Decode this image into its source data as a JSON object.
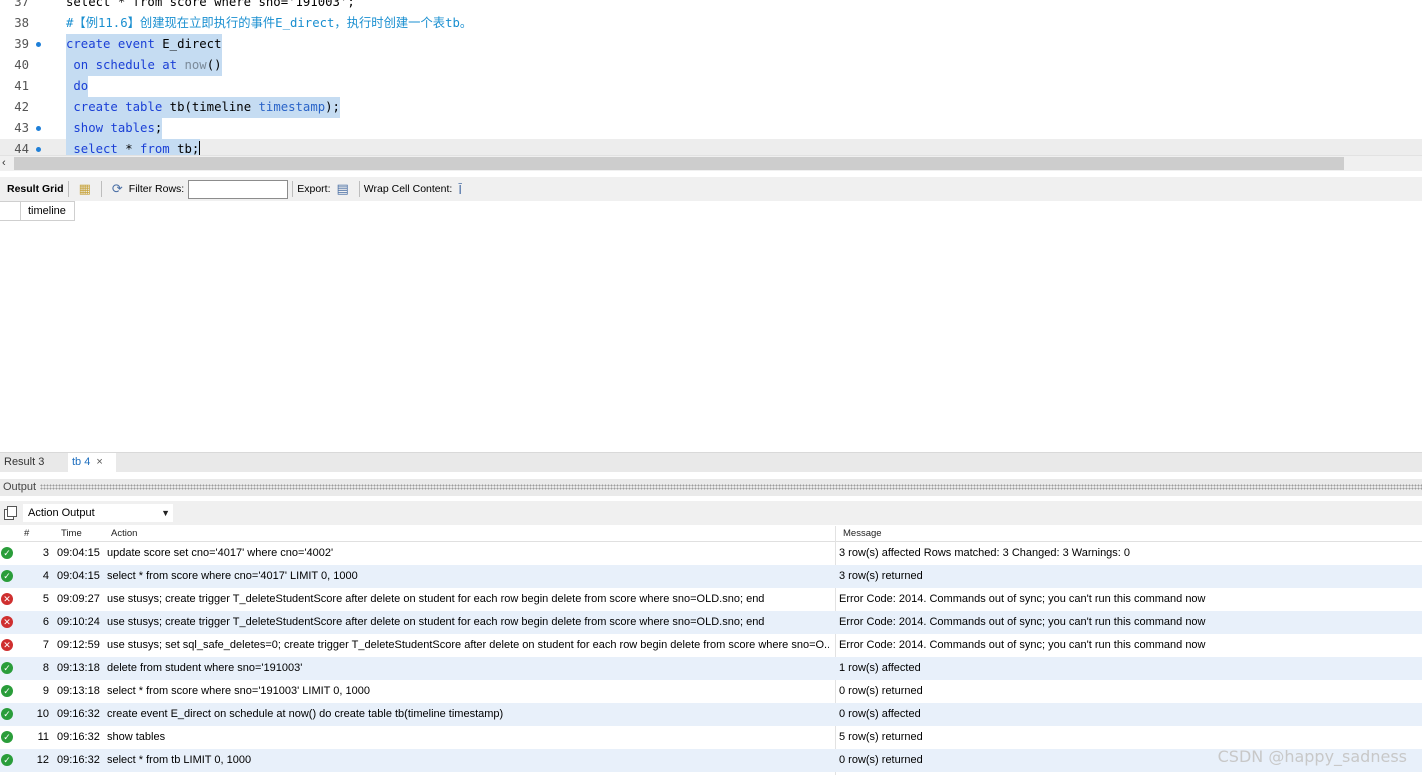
{
  "editor": {
    "lines": [
      {
        "num": "37",
        "dot": false,
        "selected": false,
        "current": false,
        "tokens": [
          {
            "t": "select * from score where sno='191003';",
            "c": "plain"
          }
        ]
      },
      {
        "num": "38",
        "dot": false,
        "selected": false,
        "current": false,
        "tokens": [
          {
            "t": "#【例11.6】创建现在立即执行的事件E_direct，执行时创建一个表tb。",
            "c": "comment"
          }
        ]
      },
      {
        "num": "39",
        "dot": true,
        "selected": true,
        "current": false,
        "tokens": [
          {
            "t": "create",
            "c": "kw"
          },
          {
            "t": " ",
            "c": "plain"
          },
          {
            "t": "event",
            "c": "kw"
          },
          {
            "t": " E_direct",
            "c": "plain"
          }
        ]
      },
      {
        "num": "40",
        "dot": false,
        "selected": true,
        "current": false,
        "tokens": [
          {
            "t": " on",
            "c": "kw"
          },
          {
            "t": " ",
            "c": "plain"
          },
          {
            "t": "schedule",
            "c": "kw"
          },
          {
            "t": " ",
            "c": "plain"
          },
          {
            "t": "at",
            "c": "kw"
          },
          {
            "t": " ",
            "c": "plain"
          },
          {
            "t": "now",
            "c": "fn"
          },
          {
            "t": "()",
            "c": "plain"
          }
        ]
      },
      {
        "num": "41",
        "dot": false,
        "selected": true,
        "current": false,
        "tokens": [
          {
            "t": " do",
            "c": "kw"
          }
        ]
      },
      {
        "num": "42",
        "dot": false,
        "selected": true,
        "current": false,
        "tokens": [
          {
            "t": " create",
            "c": "kw"
          },
          {
            "t": " ",
            "c": "plain"
          },
          {
            "t": "table",
            "c": "kw"
          },
          {
            "t": " tb(timeline ",
            "c": "plain"
          },
          {
            "t": "timestamp",
            "c": "kw2"
          },
          {
            "t": ");",
            "c": "plain"
          }
        ]
      },
      {
        "num": "43",
        "dot": true,
        "selected": true,
        "current": false,
        "tokens": [
          {
            "t": " show",
            "c": "kw"
          },
          {
            "t": " ",
            "c": "plain"
          },
          {
            "t": "tables",
            "c": "kw"
          },
          {
            "t": ";",
            "c": "plain"
          }
        ]
      },
      {
        "num": "44",
        "dot": true,
        "selected": true,
        "current": true,
        "tokens": [
          {
            "t": " select",
            "c": "kw"
          },
          {
            "t": " * ",
            "c": "plain"
          },
          {
            "t": "from",
            "c": "kw"
          },
          {
            "t": " tb;",
            "c": "plain"
          }
        ]
      }
    ]
  },
  "result_toolbar": {
    "result_grid_label": "Result Grid",
    "filter_rows_label": "Filter Rows:",
    "export_label": "Export:",
    "wrap_label": "Wrap Cell Content:"
  },
  "grid": {
    "columns": [
      "timeline"
    ]
  },
  "result_tabs": {
    "inactive": "Result 3",
    "active": "tb 4",
    "close": "×"
  },
  "output": {
    "header_label": "Output",
    "selector_value": "Action Output",
    "columns": {
      "num": "#",
      "time": "Time",
      "action": "Action",
      "message": "Message"
    },
    "rows": [
      {
        "status": "ok",
        "num": "3",
        "time": "09:04:15",
        "action": "update score set cno='4017' where cno='4002'",
        "message": "3 row(s) affected Rows matched: 3  Changed: 3  Warnings: 0"
      },
      {
        "status": "ok",
        "num": "4",
        "time": "09:04:15",
        "action": "select * from score where cno='4017' LIMIT 0, 1000",
        "message": "3 row(s) returned"
      },
      {
        "status": "err",
        "num": "5",
        "time": "09:09:27",
        "action": "use stusys; create trigger T_deleteStudentScore after delete    on student for each row begin    delete from score where sno=OLD.sno; end",
        "message": "Error Code: 2014. Commands out of sync; you can't run this command now"
      },
      {
        "status": "err",
        "num": "6",
        "time": "09:10:24",
        "action": "use stusys; create trigger T_deleteStudentScore after delete    on student for each row begin    delete from score where sno=OLD.sno; end",
        "message": "Error Code: 2014. Commands out of sync; you can't run this command now"
      },
      {
        "status": "err",
        "num": "7",
        "time": "09:12:59",
        "action": "use stusys; set sql_safe_deletes=0; create trigger T_deleteStudentScore after delete    on student for each row begin    delete from score where sno=O...",
        "message": "Error Code: 2014. Commands out of sync; you can't run this command now"
      },
      {
        "status": "ok",
        "num": "8",
        "time": "09:13:18",
        "action": "delete from student where sno='191003'",
        "message": "1 row(s) affected"
      },
      {
        "status": "ok",
        "num": "9",
        "time": "09:13:18",
        "action": "select * from score where sno='191003' LIMIT 0, 1000",
        "message": "0 row(s) returned"
      },
      {
        "status": "ok",
        "num": "10",
        "time": "09:16:32",
        "action": "create event E_direct  on schedule at now()  do  create table tb(timeline timestamp)",
        "message": "0 row(s) affected"
      },
      {
        "status": "ok",
        "num": "11",
        "time": "09:16:32",
        "action": "show tables",
        "message": "5 row(s) returned"
      },
      {
        "status": "ok",
        "num": "12",
        "time": "09:16:32",
        "action": "select * from tb LIMIT 0, 1000",
        "message": "0 row(s) returned"
      }
    ]
  },
  "watermark": "CSDN @happy_sadness",
  "icons": {
    "ok": "check-circle-icon",
    "err": "x-circle-icon"
  },
  "colors": {
    "keyword": "#1a3fd6",
    "comment": "#1a8fd0",
    "selection": "#c5dcf2",
    "ok": "#2a9d3a",
    "error": "#cf2f2f",
    "alt_row": "#e8f0fa"
  }
}
